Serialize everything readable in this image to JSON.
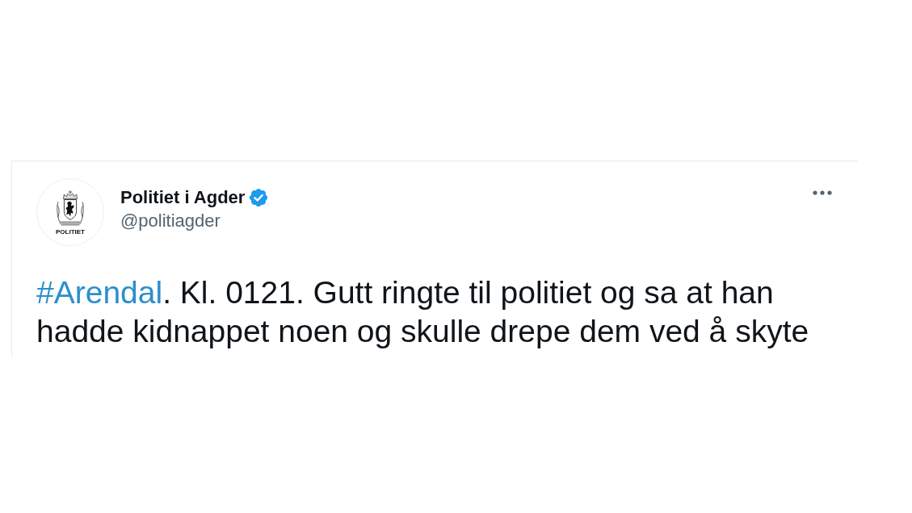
{
  "tweet": {
    "author": {
      "name": "Politiet i Agder",
      "verified": true,
      "handle": "@politiagder",
      "avatar_text": "POLITIET"
    },
    "text": [
      {
        "kind": "hashtag",
        "text": "#Arendal"
      },
      {
        "kind": "plain",
        "text": ". Kl. 0121. Gutt ringte til politiet og sa at han hadde kidnappet noen og skulle drepe dem ved å skyte"
      }
    ]
  }
}
